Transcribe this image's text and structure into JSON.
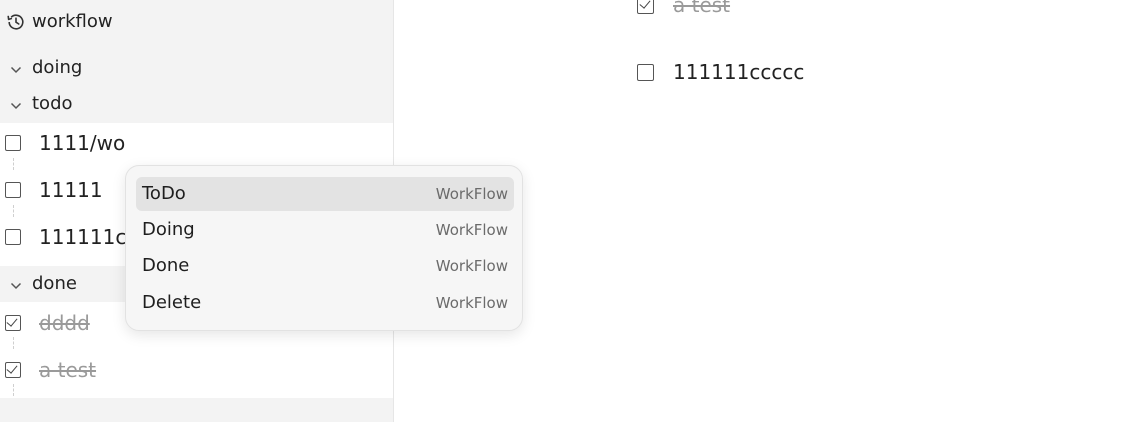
{
  "sidebar": {
    "title": "workflow",
    "groups": [
      {
        "label": "doing"
      },
      {
        "label": "todo",
        "items": [
          {
            "text": "1111/wo",
            "checked": false
          },
          {
            "text": "11111",
            "checked": false
          },
          {
            "text": "111111c",
            "checked": false
          }
        ]
      },
      {
        "label": "done",
        "items": [
          {
            "text": "dddd",
            "checked": true
          },
          {
            "text": "a test ",
            "checked": true
          }
        ]
      }
    ]
  },
  "main": {
    "items": [
      {
        "text": "a test ",
        "checked": true
      },
      {
        "text": "111111ccccc",
        "checked": false
      }
    ]
  },
  "context_menu": {
    "items": [
      {
        "label": "ToDo",
        "shortcut": "WorkFlow",
        "active": true
      },
      {
        "label": "Doing",
        "shortcut": "WorkFlow"
      },
      {
        "label": "Done",
        "shortcut": "WorkFlow"
      },
      {
        "label": "Delete",
        "shortcut": "WorkFlow"
      }
    ]
  }
}
